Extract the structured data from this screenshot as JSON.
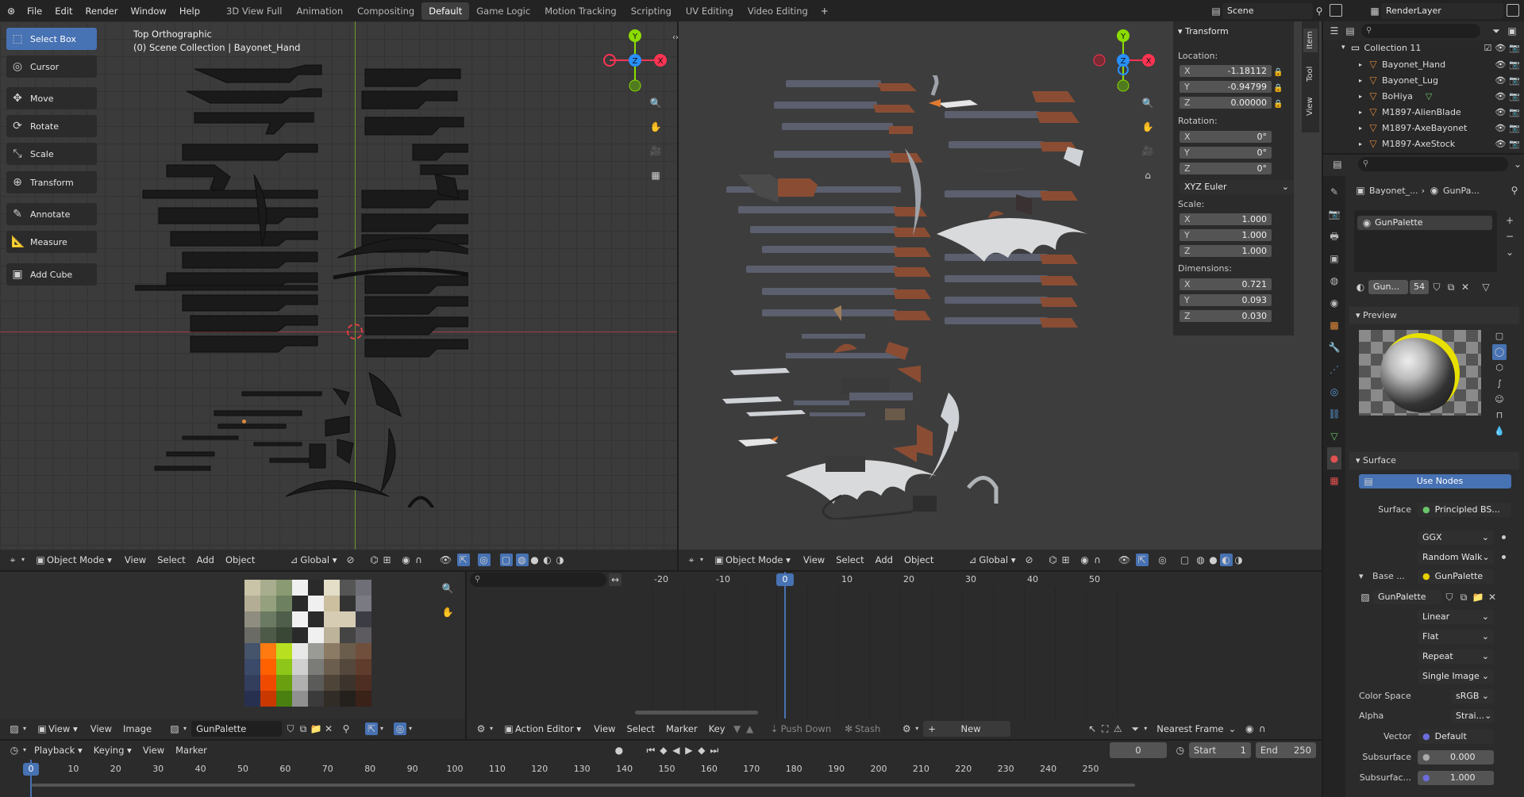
{
  "app": {
    "title": "Blender"
  },
  "menu": {
    "file": "File",
    "edit": "Edit",
    "render": "Render",
    "window": "Window",
    "help": "Help"
  },
  "workspaces": [
    "3D View Full",
    "Animation",
    "Compositing",
    "Default",
    "Game Logic",
    "Motion Tracking",
    "Scripting",
    "UV Editing",
    "Video Editing"
  ],
  "active_workspace": "Default",
  "scene": {
    "name": "Scene",
    "render_layer": "RenderLayer"
  },
  "viewport_left": {
    "view_name": "Top Orthographic",
    "collection_info": "(0) Scene Collection | Bayonet_Hand",
    "header": {
      "mode": "Object Mode",
      "view": "View",
      "select": "Select",
      "add": "Add",
      "object": "Object",
      "orientation": "Global"
    }
  },
  "viewport_right": {
    "header": {
      "mode": "Object Mode",
      "view": "View",
      "select": "Select",
      "add": "Add",
      "object": "Object",
      "orientation": "Global"
    }
  },
  "gizmo": {
    "x": "X",
    "y": "Y",
    "z": "Z"
  },
  "toolbar": {
    "select_box": "Select Box",
    "cursor": "Cursor",
    "move": "Move",
    "rotate": "Rotate",
    "scale": "Scale",
    "transform": "Transform",
    "annotate": "Annotate",
    "measure": "Measure",
    "add_cube": "Add Cube"
  },
  "side_tabs": {
    "item": "Item",
    "tool": "Tool",
    "view": "View"
  },
  "transform_panel": {
    "title": "Transform",
    "location_label": "Location:",
    "location": {
      "x": "-1.18112",
      "y": "-0.94799",
      "z": "0.00000"
    },
    "rotation_label": "Rotation:",
    "rotation": {
      "x": "0°",
      "y": "0°",
      "z": "0°"
    },
    "rotation_mode": "XYZ Euler",
    "scale_label": "Scale:",
    "scale": {
      "x": "1.000",
      "y": "1.000",
      "z": "1.000"
    },
    "dimensions_label": "Dimensions:",
    "dimensions": {
      "x": "0.721",
      "y": "0.093",
      "z": "0.030"
    }
  },
  "outliner": {
    "collection": "Collection 11",
    "items": [
      "Bayonet_Hand",
      "Bayonet_Lug",
      "BoHiya",
      "M1897-AlienBlade",
      "M1897-AxeBayonet",
      "M1897-AxeStock"
    ]
  },
  "properties": {
    "breadcrumb_object": "Bayonet_...",
    "breadcrumb_material": "GunPa...",
    "material_slot": "GunPalette",
    "material_name": "Gun...",
    "material_users": "54",
    "preview_label": "Preview",
    "surface_section": "Surface",
    "use_nodes": "Use Nodes",
    "surface_label": "Surface",
    "surface_value": "Principled BS...",
    "distribution": "GGX",
    "subsurface_method": "Random Walk",
    "base_color_label": "Base ...",
    "base_color_value": "GunPalette",
    "image_name": "GunPalette",
    "interpolation": "Linear",
    "projection": "Flat",
    "extension": "Repeat",
    "source": "Single Image",
    "color_space_label": "Color Space",
    "color_space_value": "sRGB",
    "alpha_label": "Alpha",
    "alpha_value": "Strai...",
    "vector_label": "Vector",
    "vector_value": "Default",
    "subsurface_label": "Subsurface",
    "subsurface_value": "0.000",
    "subsurface_radius_label": "Subsurfac...",
    "subsurface_radius_value": "1.000"
  },
  "image_editor": {
    "view_menu": "View",
    "view": "View",
    "image": "Image",
    "image_name": "GunPalette"
  },
  "action_editor": {
    "mode": "Action Editor",
    "view": "View",
    "select": "Select",
    "marker": "Marker",
    "key": "Key",
    "push_down": "Push Down",
    "stash": "Stash",
    "new": "New",
    "snap": "Nearest Frame",
    "ruler": [
      "-20",
      "-10",
      "0",
      "10",
      "20",
      "30",
      "40",
      "50"
    ],
    "current_frame": "0"
  },
  "timeline": {
    "playback": "Playback",
    "keying": "Keying",
    "view": "View",
    "marker": "Marker",
    "current_frame": "0",
    "start_label": "Start",
    "start": "1",
    "end_label": "End",
    "end": "250",
    "ruler": [
      "0",
      "10",
      "20",
      "30",
      "40",
      "50",
      "60",
      "70",
      "80",
      "90",
      "100",
      "110",
      "120",
      "130",
      "140",
      "150",
      "160",
      "170",
      "180",
      "190",
      "200",
      "210",
      "220",
      "230",
      "240",
      "250"
    ],
    "playhead": "0"
  },
  "colors": {
    "accent": "#4772b3",
    "axis_x": "#ff3352",
    "axis_y": "#8bdc00",
    "axis_z": "#2890ff",
    "selected_icon": "#e08a3a"
  }
}
